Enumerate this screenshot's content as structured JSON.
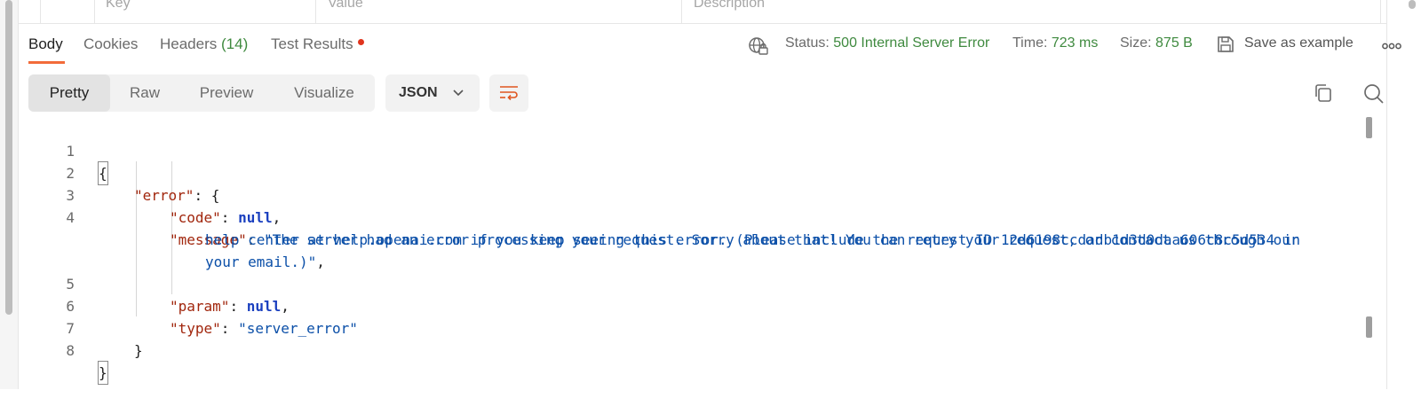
{
  "params_header": {
    "key": "Key",
    "value": "Value",
    "description": "Description"
  },
  "response_tabs": {
    "body": "Body",
    "cookies": "Cookies",
    "headers": "Headers",
    "headers_count": "(14)",
    "test_results": "Test Results"
  },
  "status": {
    "status_label": "Status:",
    "status_value": "500 Internal Server Error",
    "time_label": "Time:",
    "time_value": "723 ms",
    "size_label": "Size:",
    "size_value": "875 B",
    "save_example": "Save as example",
    "status_color": "#3f8a3f"
  },
  "view_modes": [
    "Pretty",
    "Raw",
    "Preview",
    "Visualize"
  ],
  "active_view": "Pretty",
  "format": "JSON",
  "icons": [
    "globe-lock-icon",
    "save-icon",
    "more-icon",
    "chevron-down-icon",
    "wrap-lines-icon",
    "copy-icon",
    "search-icon"
  ],
  "accent_color": "#f26b3a",
  "editor": {
    "line_numbers": [
      "1",
      "2",
      "3",
      "4",
      "5",
      "6",
      "7",
      "8"
    ],
    "open_brace": "{",
    "error_key": "\"error\"",
    "colon_open": ": {",
    "code_key": "\"code\"",
    "code_val": "null",
    "message_key": "\"message\"",
    "message_line1": "\"The server had an error processing your request. Sorry about that! You can retry your request, or contact us through our",
    "message_line2": "help center at help.openai.com if you keep seeing this error. (Please include the request ID 12d6198ccdadb1d3d0daa606c8c5d534 in",
    "message_line3": "your email.)\"",
    "param_key": "\"param\"",
    "param_val": "null",
    "type_key": "\"type\"",
    "type_val": "\"server_error\"",
    "inner_close": "}",
    "close_brace": "}",
    "colon": ": ",
    "comma": ","
  }
}
